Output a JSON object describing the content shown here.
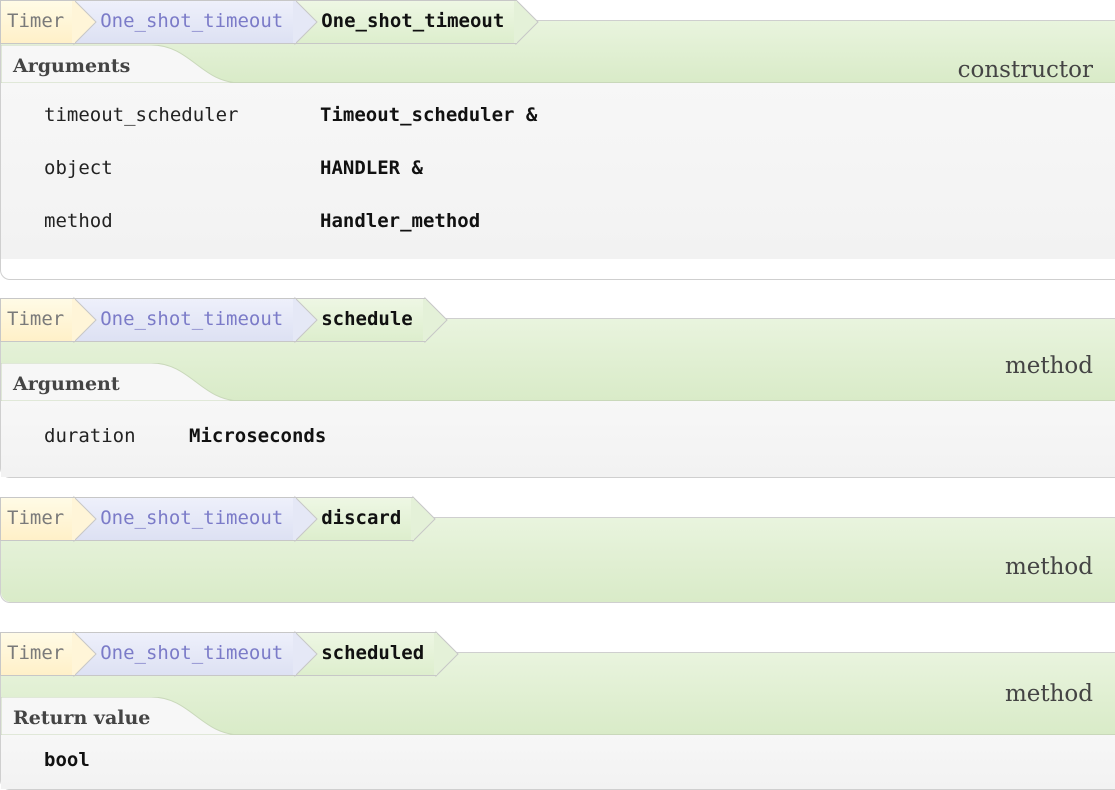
{
  "entries": [
    {
      "class": "Timer",
      "type": "One_shot_timeout",
      "name": "One_shot_timeout",
      "kind": "constructor",
      "section": "Arguments",
      "args": [
        {
          "name": "timeout_scheduler",
          "type": "Timeout_scheduler &"
        },
        {
          "name": "object",
          "type": "HANDLER &"
        },
        {
          "name": "method",
          "type": "Handler_method"
        }
      ]
    },
    {
      "class": "Timer",
      "type": "One_shot_timeout",
      "name": "schedule",
      "kind": "method",
      "section": "Argument",
      "args": [
        {
          "name": "duration",
          "type": "Microseconds"
        }
      ]
    },
    {
      "class": "Timer",
      "type": "One_shot_timeout",
      "name": "discard",
      "kind": "method"
    },
    {
      "class": "Timer",
      "type": "One_shot_timeout",
      "name": "scheduled",
      "kind": "method",
      "section": "Return value",
      "return_type": "bool"
    }
  ],
  "colors": {
    "class_tab": "#fff0c8",
    "type_tab": "#dde1f3",
    "name_tab": "#ddeecd",
    "header": "#e3f0d6"
  }
}
